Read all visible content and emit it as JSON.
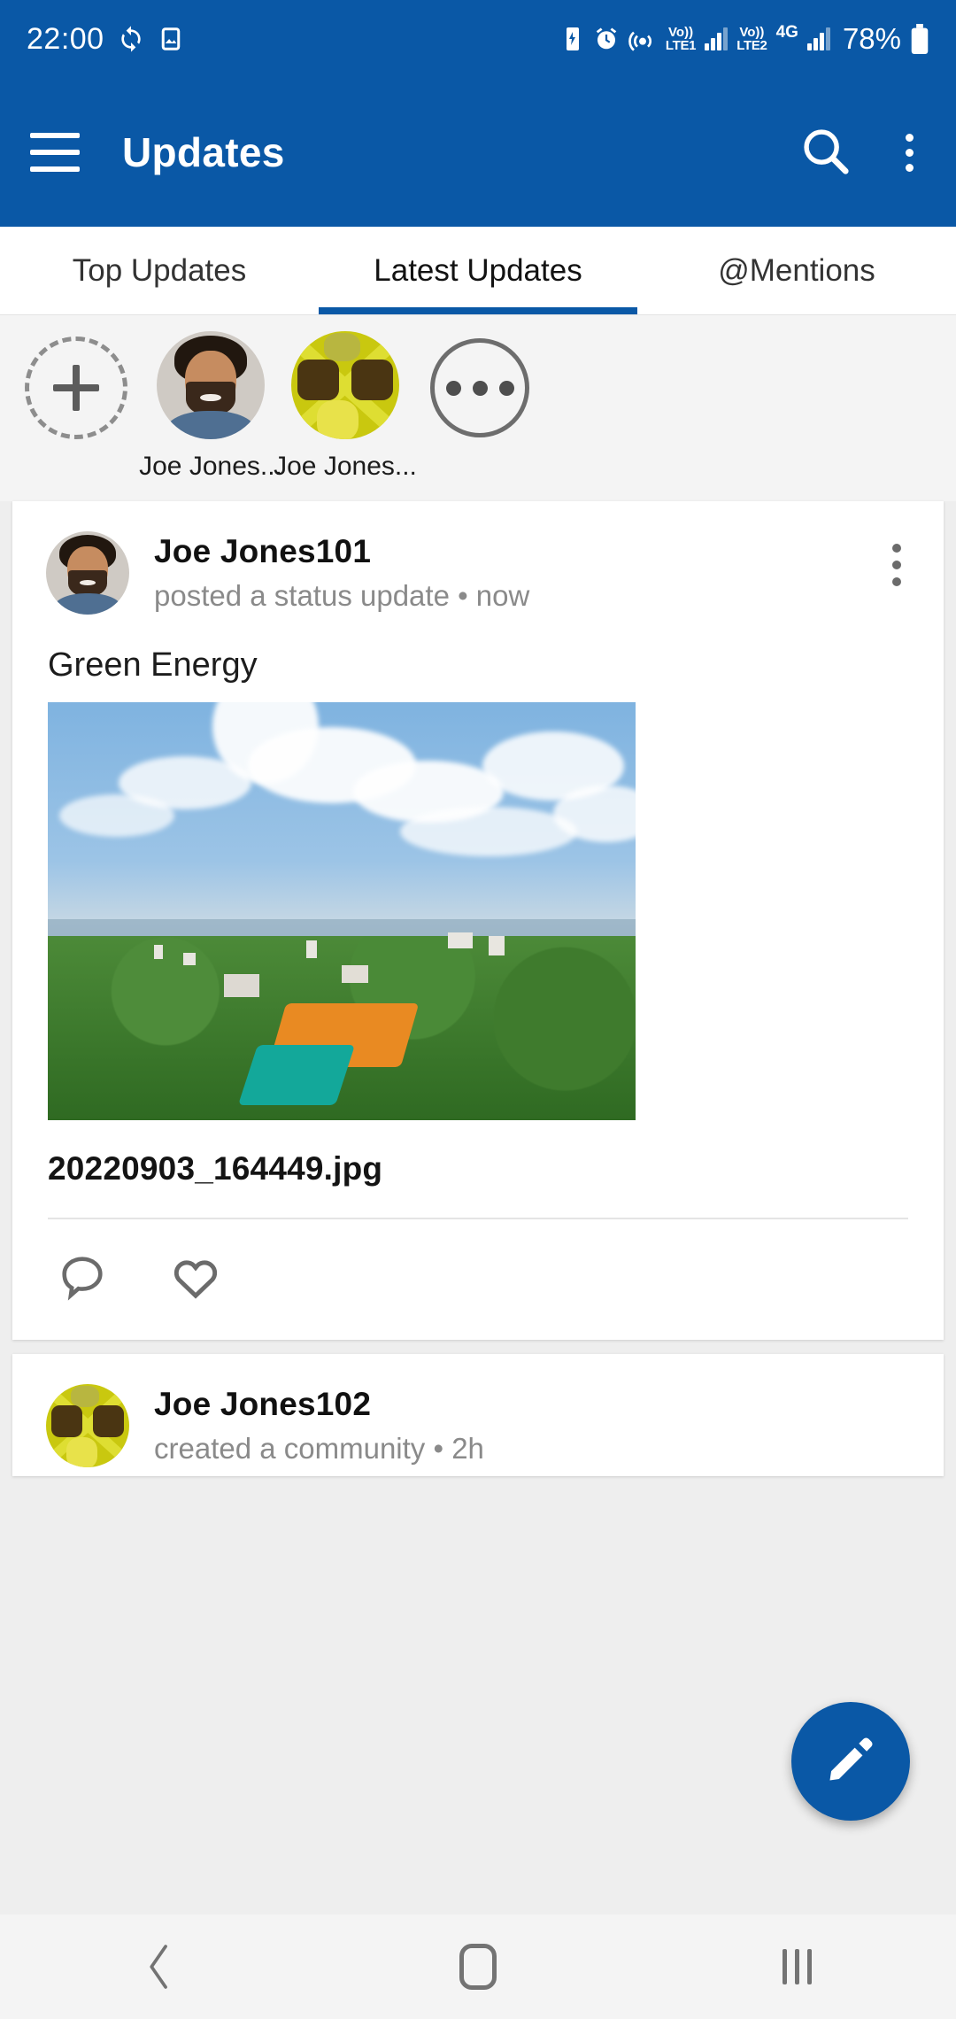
{
  "status_bar": {
    "time": "22:00",
    "battery_percent": "78%",
    "network": {
      "sim1_label_top": "Vo))",
      "sim1_label_bottom": "LTE1",
      "sim2_label_top": "Vo))",
      "sim2_label_bottom": "LTE2",
      "data_type": "4G"
    },
    "icons": [
      "sync-icon",
      "image-icon",
      "battery-saver-icon",
      "alarm-icon",
      "hotspot-icon"
    ]
  },
  "app_bar": {
    "title": "Updates",
    "menu_icon": "hamburger-icon",
    "search_icon": "search-icon",
    "overflow_icon": "more-vertical-icon",
    "background": "#0a58a6"
  },
  "tabs": [
    {
      "label": "Top Updates",
      "active": false
    },
    {
      "label": "Latest Updates",
      "active": true
    },
    {
      "label": "@Mentions",
      "active": false
    }
  ],
  "stories": {
    "add_label": "",
    "items": [
      {
        "label": "Joe Jones...",
        "avatar": "person"
      },
      {
        "label": "Joe Jones...",
        "avatar": "food"
      }
    ],
    "more_label": ""
  },
  "feed": [
    {
      "author": "Joe Jones101",
      "subtitle": "posted a status update • now",
      "avatar": "person",
      "title": "Green Energy",
      "attachment_name": "20220903_164449.jpg",
      "actions": [
        {
          "name": "comment-icon",
          "label": ""
        },
        {
          "name": "like-icon",
          "label": ""
        }
      ]
    },
    {
      "author": "Joe Jones102",
      "subtitle": "created a community • 2h",
      "avatar": "food"
    }
  ],
  "fab": {
    "icon": "edit-pencil-icon",
    "color": "#0a58a6"
  },
  "nav_bar": {
    "back": "back-icon",
    "home": "home-icon",
    "recents": "recents-icon"
  }
}
